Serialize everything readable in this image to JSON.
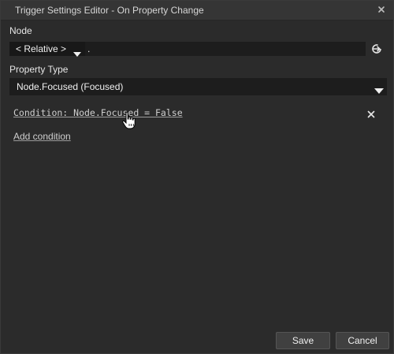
{
  "window": {
    "title": "Trigger Settings Editor - On Property Change"
  },
  "node": {
    "label": "Node",
    "relative_option": "< Relative >",
    "path_value": "."
  },
  "property_type": {
    "label": "Property Type",
    "selected": "Node.Focused (Focused)"
  },
  "conditions": [
    {
      "text": "Condition: Node.Focused = False"
    }
  ],
  "add_condition_label": "Add condition",
  "footer": {
    "save_label": "Save",
    "cancel_label": "Cancel"
  },
  "icons": {
    "close": "close-icon",
    "go": "arrow-right-circle-icon",
    "remove": "remove-x-icon",
    "dropdown": "caret-down-icon",
    "cursor": "hand-pointer-icon"
  },
  "colors": {
    "background": "#2b2b2b",
    "titlebar": "#353535",
    "field": "#1d1d1d",
    "button": "#404040",
    "text": "#e6e6e6"
  }
}
